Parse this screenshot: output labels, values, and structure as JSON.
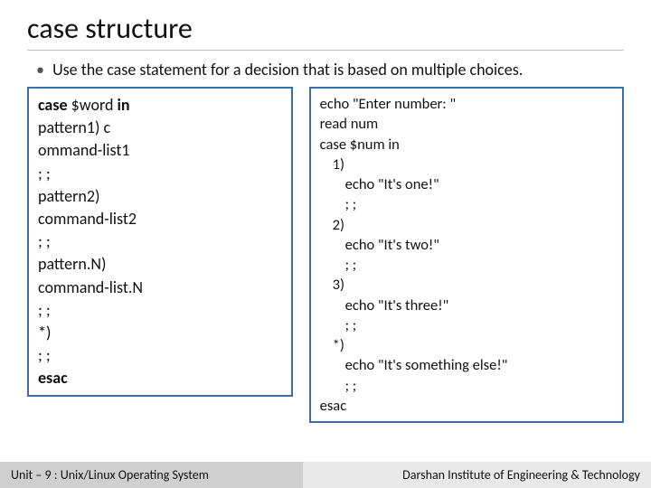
{
  "title": "case structure",
  "bullet": "Use the case statement for a decision that is based on multiple choices.",
  "syntax": {
    "l1a": "case ",
    "l1b": "$word ",
    "l1c": "in",
    "l2": "pattern1) c",
    "l3": "ommand-list1",
    "l4": "; ;",
    "l5": "pattern2)",
    "l6": "command-list2",
    "l7": "; ;",
    "l8": "pattern.N)",
    "l9": "command-list.N",
    "l10": "; ;",
    "l11": "*)",
    "l12": "; ;",
    "l13": "esac"
  },
  "example": {
    "l1": "echo \"Enter number: \"",
    "l2": "read num",
    "l3": "case $num in",
    "l4": "1)",
    "l5": "echo \"It's one!\"",
    "l6": "; ;",
    "l7": "2)",
    "l8": "echo \"It's two!\"",
    "l9": "; ;",
    "l10": "3)",
    "l11": "echo \"It's three!\"",
    "l12": "; ;",
    "l13": "*)",
    "l14": "echo \"It's something else!\"",
    "l15": "; ;",
    "l16": "esac"
  },
  "footer": {
    "left": "Unit – 9  : Unix/Linux Operating System",
    "right": "Darshan Institute of Engineering & Technology"
  }
}
